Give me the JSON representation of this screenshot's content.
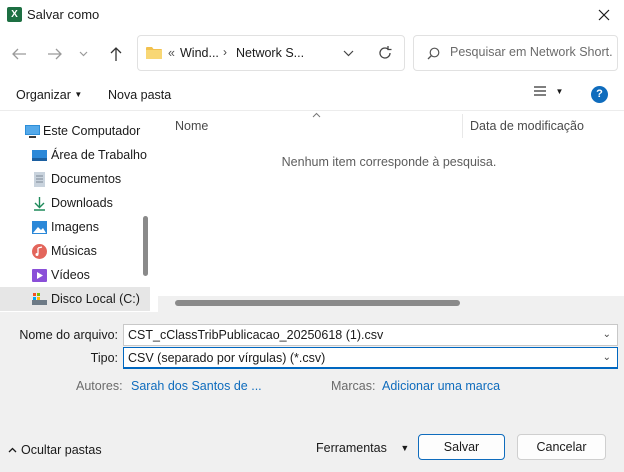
{
  "window": {
    "title": "Salvar como",
    "app_icon_letter": "X",
    "app_icon_color": "#1d6f42"
  },
  "navigation": {
    "back_icon": "arrow-left-icon",
    "forward_icon": "arrow-right-icon",
    "recent_icon": "chevron-down-icon",
    "up_icon": "arrow-up-icon",
    "address": {
      "overflow": "«",
      "crumb1": "Wind...",
      "sep": "›",
      "crumb2": "Network S..."
    },
    "search_placeholder": "Pesquisar em Network Short..."
  },
  "toolbar": {
    "organize_label": "Organizar",
    "new_folder_label": "Nova pasta"
  },
  "sidebar": {
    "items": [
      {
        "label": "Este Computador",
        "icon": "computer-icon"
      },
      {
        "label": "Área de Trabalho",
        "icon": "desktop-icon"
      },
      {
        "label": "Documentos",
        "icon": "documents-icon"
      },
      {
        "label": "Downloads",
        "icon": "downloads-icon"
      },
      {
        "label": "Imagens",
        "icon": "pictures-icon"
      },
      {
        "label": "Músicas",
        "icon": "music-icon"
      },
      {
        "label": "Vídeos",
        "icon": "videos-icon"
      },
      {
        "label": "Disco Local (C:)",
        "icon": "drive-icon"
      }
    ]
  },
  "files": {
    "columns": [
      "Nome",
      "Data de modificação"
    ],
    "empty_message": "Nenhum item corresponde à pesquisa."
  },
  "form": {
    "filename_label": "Nome do arquivo:",
    "filename_value": "CST_cClassTribPublicacao_20250618 (1).csv",
    "type_label": "Tipo:",
    "type_value": "CSV (separado por vírgulas) (*.csv)",
    "authors_label": "Autores:",
    "authors_value": "Sarah dos Santos de ...",
    "tags_label": "Marcas:",
    "tags_value": "Adicionar uma marca"
  },
  "footer": {
    "hide_folders_label": "Ocultar pastas",
    "tools_label": "Ferramentas",
    "save_label": "Salvar",
    "cancel_label": "Cancelar"
  },
  "colors": {
    "accent": "#0067c0",
    "link": "#0f6cbd",
    "help": "#0f6cbd"
  }
}
